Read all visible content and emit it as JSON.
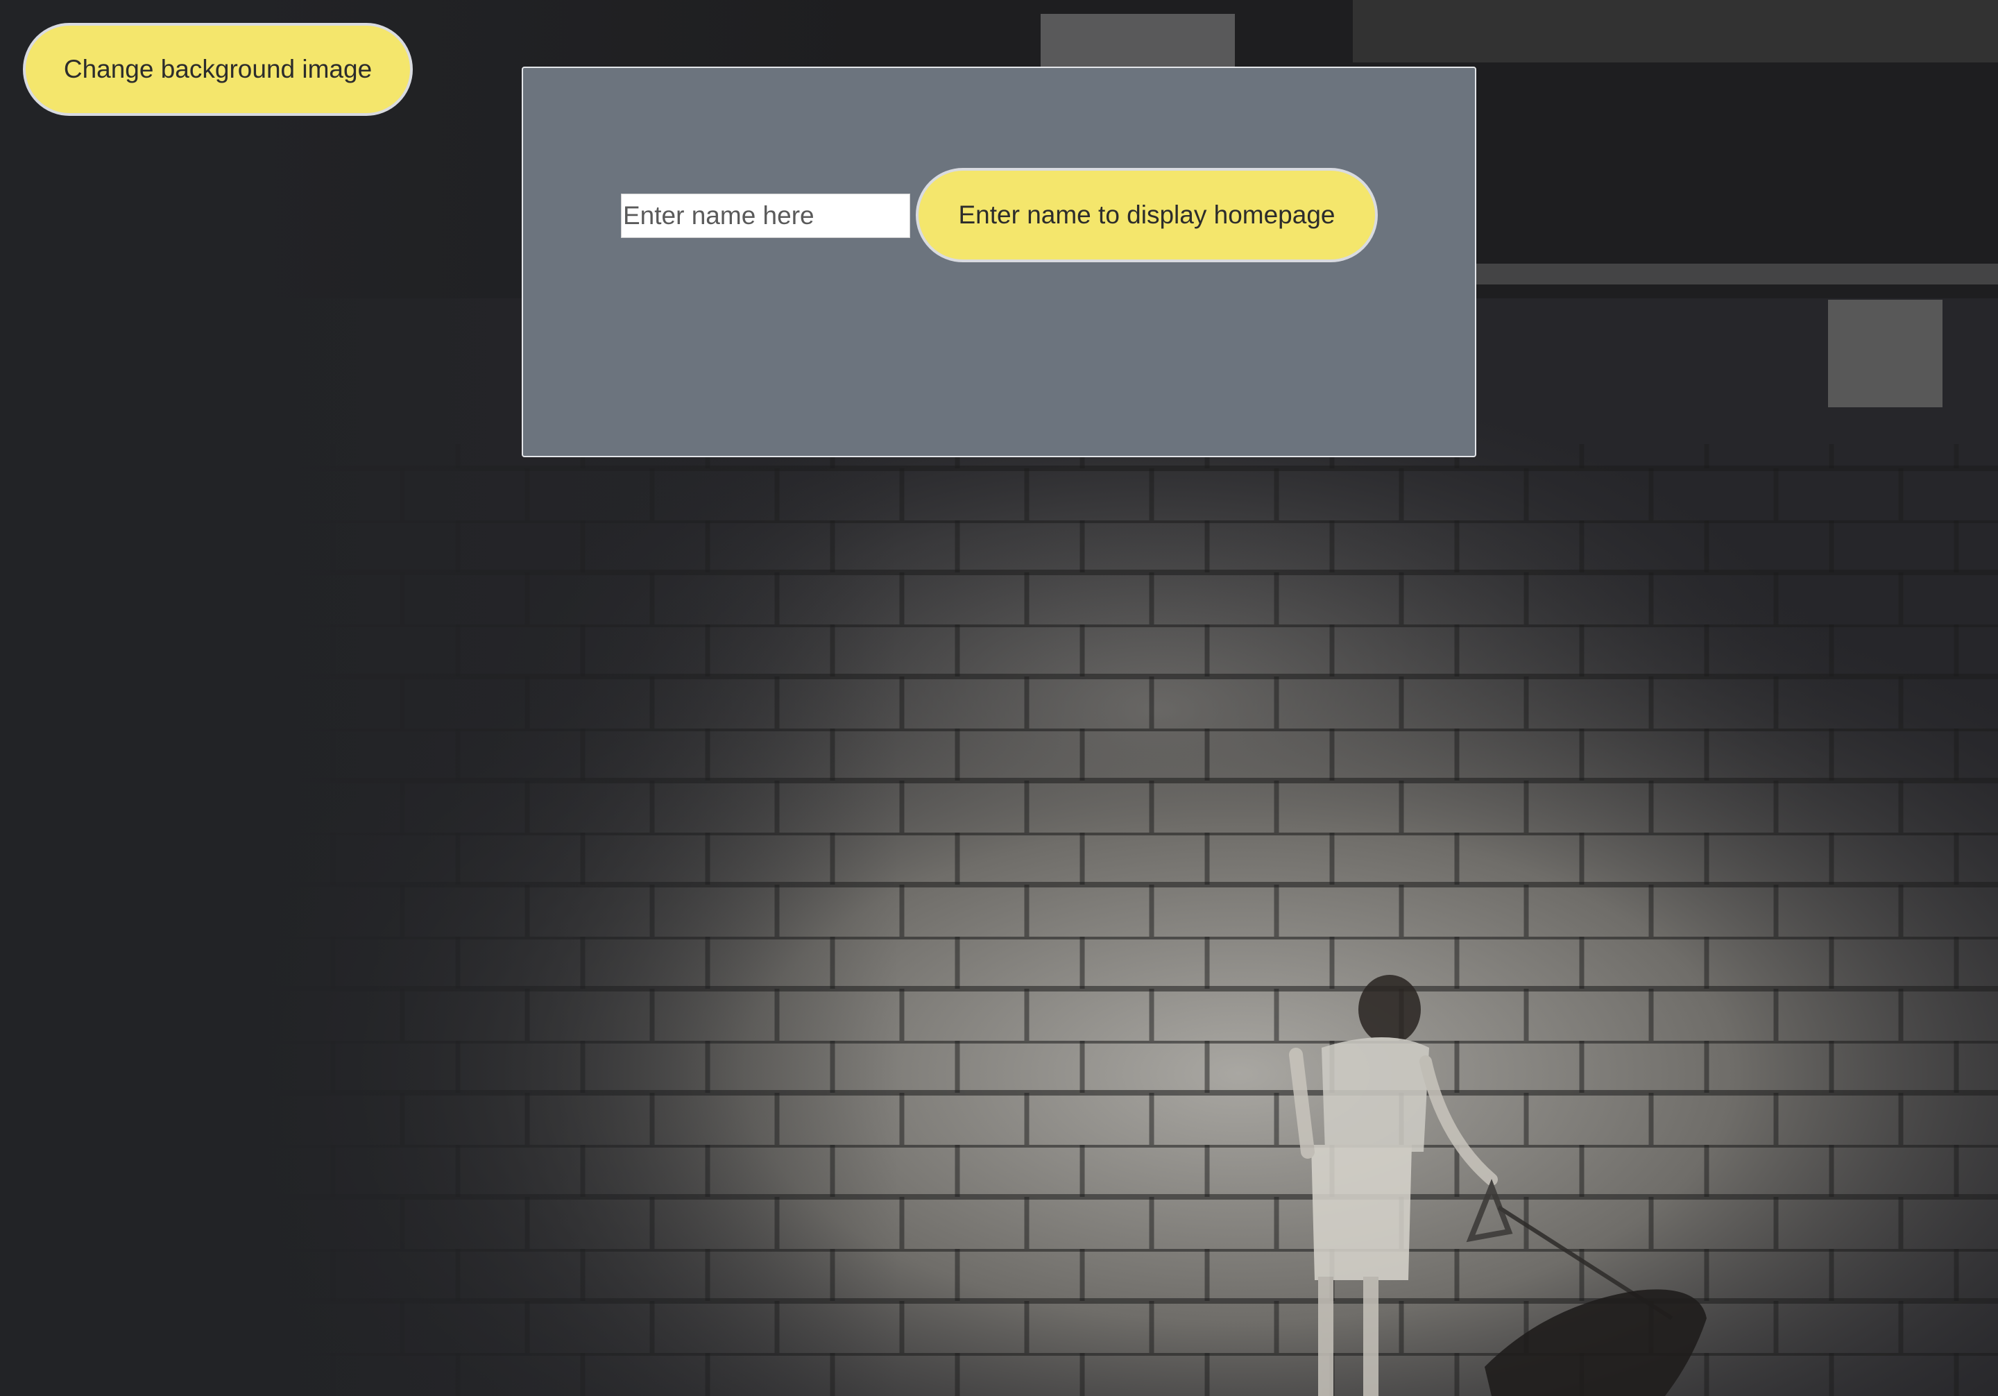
{
  "buttons": {
    "change_background": "Change background image",
    "enter_name": "Enter name to display homepage"
  },
  "name_input": {
    "placeholder": "Enter name here",
    "value": ""
  },
  "colors": {
    "button_fill": "#f4e66c",
    "button_border": "#d9dbe0",
    "panel_fill": "#6c747e",
    "page_background": "#222326"
  },
  "background_image": {
    "depicts": "photograph"
  }
}
